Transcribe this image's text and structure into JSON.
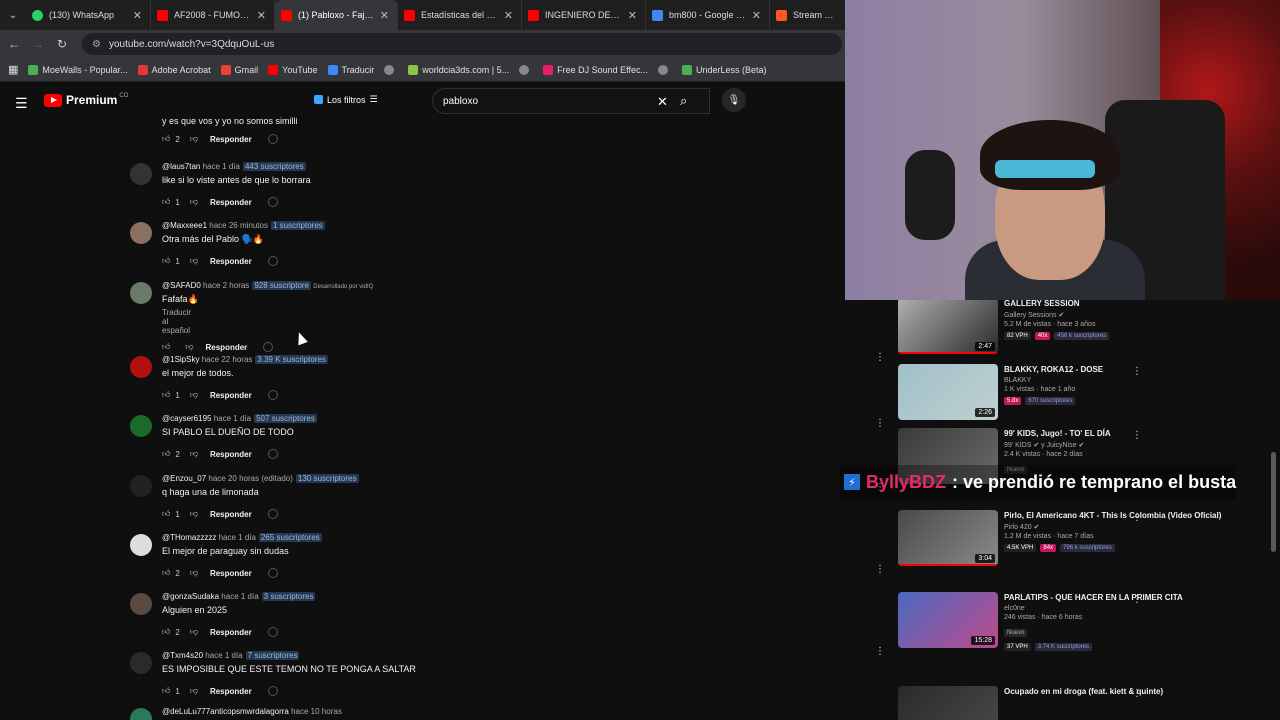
{
  "browser": {
    "tabs": [
      {
        "label": "(130) WhatsApp",
        "color": "#25d366"
      },
      {
        "label": "AF2008 - FUMO Y DE",
        "color": "#ff0000"
      },
      {
        "label": "(1) Pabloxo - Fajos de",
        "color": "#ff0000"
      },
      {
        "label": "Estadísticas del canal",
        "color": "#ff0000"
      },
      {
        "label": "INGENIERO DE SONI",
        "color": "#ff0000"
      },
      {
        "label": "bm800 - Google Shop",
        "color": "#4285f4"
      },
      {
        "label": "Stream ultimate",
        "color": "#ff5722"
      }
    ],
    "url": "youtube.com/watch?v=3QdquOuL-us",
    "bookmarks": [
      {
        "label": "MoeWalls - Popular...",
        "color": "#4caf50"
      },
      {
        "label": "Adobe Acrobat",
        "color": "#e53935"
      },
      {
        "label": "Gmail",
        "color": "#ea4335"
      },
      {
        "label": "YouTube",
        "color": "#ff0000"
      },
      {
        "label": "Traducir",
        "color": "#4285f4"
      },
      {
        "label": "",
        "color": "#888888"
      },
      {
        "label": "worldcia3ds.com | 5...",
        "color": "#8bc34a"
      },
      {
        "label": "",
        "color": "#888888"
      },
      {
        "label": "Free DJ Sound Effec...",
        "color": "#e91e63"
      },
      {
        "label": "",
        "color": "#888888"
      },
      {
        "label": "UnderLess (Beta)",
        "color": "#4caf50"
      }
    ]
  },
  "youtube": {
    "logo": "Premium",
    "logo_suffix": "CO",
    "filters": "Los filtros",
    "search_value": "pabloxo"
  },
  "comments": [
    {
      "author": "",
      "time": "",
      "subs": "",
      "extra": "",
      "text": "y es que vos y yo no somos similli",
      "likes": "2",
      "avatar": "#555555",
      "translate": ""
    },
    {
      "author": "@laus7tan",
      "time": "hace 1 día",
      "subs": "443 suscriptores",
      "extra": "",
      "text": "like si lo viste antes de que lo borrara",
      "likes": "1",
      "avatar": "#333333",
      "translate": ""
    },
    {
      "author": "@Maxxeee1",
      "time": "hace 26 minutos",
      "subs": "1 suscriptores",
      "extra": "",
      "text": "Otra más del Pablo 🗣️🔥",
      "likes": "1",
      "avatar": "#8a7060",
      "translate": ""
    },
    {
      "author": "@SAFAD0",
      "time": "hace 2 horas",
      "subs": "928 suscriptore",
      "extra": "Desarrollado por vidIQ",
      "text": "Fafafa🔥",
      "likes": "",
      "avatar": "#6a7a6a",
      "translate": "Traducir al español"
    },
    {
      "author": "@1SipSky",
      "time": "hace 22 horas",
      "subs": "3.39 K suscriptores",
      "extra": "",
      "text": "el mejor de todos.",
      "likes": "1",
      "avatar": "#b01010",
      "translate": ""
    },
    {
      "author": "@cayser6195",
      "time": "hace 1 día",
      "subs": "507 suscriptores",
      "extra": "",
      "text": "SI PABLO EL DUEÑO DE TODO",
      "likes": "2",
      "avatar": "#1a6a2a",
      "translate": ""
    },
    {
      "author": "@Enzou_07",
      "time": "hace 20 horas (editado)",
      "subs": "130 suscriptores",
      "extra": "",
      "text": "q haga una de limonada",
      "likes": "1",
      "avatar": "#222222",
      "translate": ""
    },
    {
      "author": "@THomazzzzz",
      "time": "hace 1 día",
      "subs": "265 suscriptores",
      "extra": "",
      "text": "El mejor de paraguay sin dudas",
      "likes": "2",
      "avatar": "#dddddd",
      "translate": ""
    },
    {
      "author": "@gonzaSudaka",
      "time": "hace 1 día",
      "subs": "3 suscriptores",
      "extra": "",
      "text": "Alguien en 2025",
      "likes": "2",
      "avatar": "#5a4a40",
      "translate": ""
    },
    {
      "author": "@Txm4s20",
      "time": "hace 1 día",
      "subs": "7 suscriptores",
      "extra": "",
      "text": "ES IMPOSIBLE QUE ESTE TEMON NO TE PONGA A SALTAR",
      "likes": "1",
      "avatar": "#2a2a2a",
      "translate": ""
    },
    {
      "author": "@deLuLu777anticopsmwrdalagorra",
      "time": "hace 10 horas",
      "subs": "",
      "extra": "",
      "text": "",
      "likes": "",
      "avatar": "#2a7a5a",
      "translate": ""
    }
  ],
  "reply_label": "Responder",
  "videos": [
    {
      "title": "GALLERY SESSION",
      "channel": "Gallery Sessions ✔",
      "stats": "5.2 M de vistas · hace 3 años",
      "vph": "82 VPH",
      "mult": "40x",
      "subs": "456 k suscriptores",
      "duration": "2:47",
      "colors": [
        "#b0b0b0",
        "#2a2a2a"
      ],
      "new": ""
    },
    {
      "title": "BLAKKY, ROKA12 - DOSE",
      "channel": "BLAKKY",
      "stats": "1 K vistas · hace 1 año",
      "vph": "",
      "mult": "5.8x",
      "subs": "670 suscriptores",
      "duration": "2:26",
      "colors": [
        "#a0c0c8",
        "#c0d0d0"
      ],
      "new": ""
    },
    {
      "title": "99' KIDS, Jugo! - TO' EL DÍA",
      "channel": "99' KIDS ✔ y JuicyNise ✔",
      "stats": "2.4 K vistas · hace 2 días",
      "vph": "",
      "mult": "",
      "subs": "",
      "duration": "",
      "colors": [
        "#3a3a3a",
        "#6a6a6a"
      ],
      "new": "Nuevo"
    },
    {
      "title": "Pirlo, El Americano 4KT - This Is Colombia (Video Oficial)",
      "channel": "Pirlo 420 ✔",
      "stats": "1.2 M de vistas · hace 7 días",
      "vph": "4.5K VPH",
      "mult": "84x",
      "subs": "796 k suscriptores",
      "duration": "3:04",
      "colors": [
        "#4a4a4a",
        "#8a8a8a"
      ],
      "new": ""
    },
    {
      "title": "PARLATIPS - QUE HACER EN LA PRIMER CITA",
      "channel": "elc0ne",
      "stats": "246 vistas · hace 6 horas",
      "vph": "37 VPH",
      "mult": "",
      "subs": "3.74 K suscriptores",
      "duration": "15:28",
      "colors": [
        "#4a6ac0",
        "#c04a8a"
      ],
      "new": "Nuevo"
    },
    {
      "title": "Ocupado en mi droga (feat. kiett & quinte)",
      "channel": "",
      "stats": "",
      "vph": "",
      "mult": "",
      "subs": "",
      "duration": "",
      "colors": [
        "#2a2a2a",
        "#4a4a4a"
      ],
      "new": ""
    }
  ],
  "chat_overlay": {
    "user": "ByllyBDZ",
    "message": ": ve prendió re temprano el busta"
  }
}
